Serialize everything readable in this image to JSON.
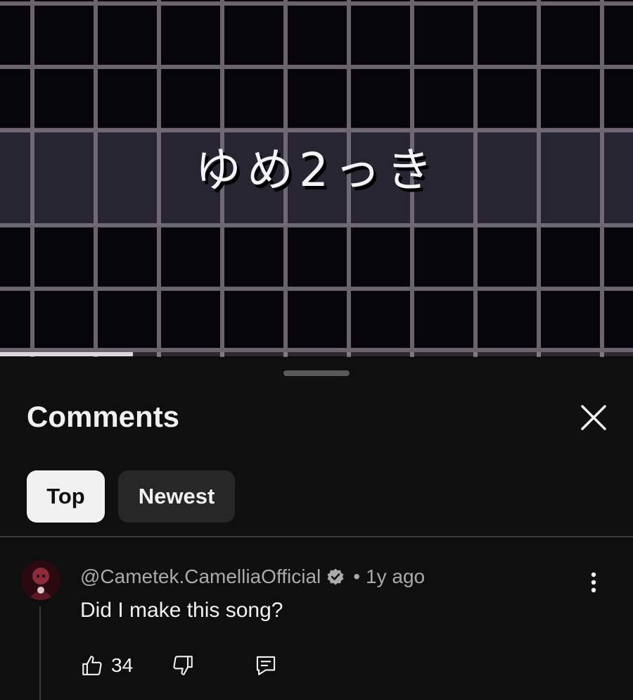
{
  "video": {
    "title_text": "ゆめ2っき",
    "progress_percent": 21
  },
  "comments_sheet": {
    "title": "Comments",
    "sort_chips": [
      {
        "label": "Top",
        "selected": true
      },
      {
        "label": "Newest",
        "selected": false
      }
    ]
  },
  "comment": {
    "author": "@Cametek.CamelliaOfficial",
    "verified": true,
    "separator": "•",
    "time": "1y ago",
    "text": "Did I make this song?",
    "like_count": "34"
  },
  "icons": {
    "close": "close-icon",
    "verified": "verified-badge-icon",
    "more": "more-vert-icon",
    "like": "thumb-up-icon",
    "dislike": "thumb-down-icon",
    "reply": "reply-comment-icon"
  },
  "colors": {
    "sheet_background": "#0f0f0f",
    "chip_selected": "#f1f1f1",
    "chip_unselected": "#272727",
    "text_primary": "#f1f1f1",
    "text_secondary": "#aaaaaa"
  }
}
